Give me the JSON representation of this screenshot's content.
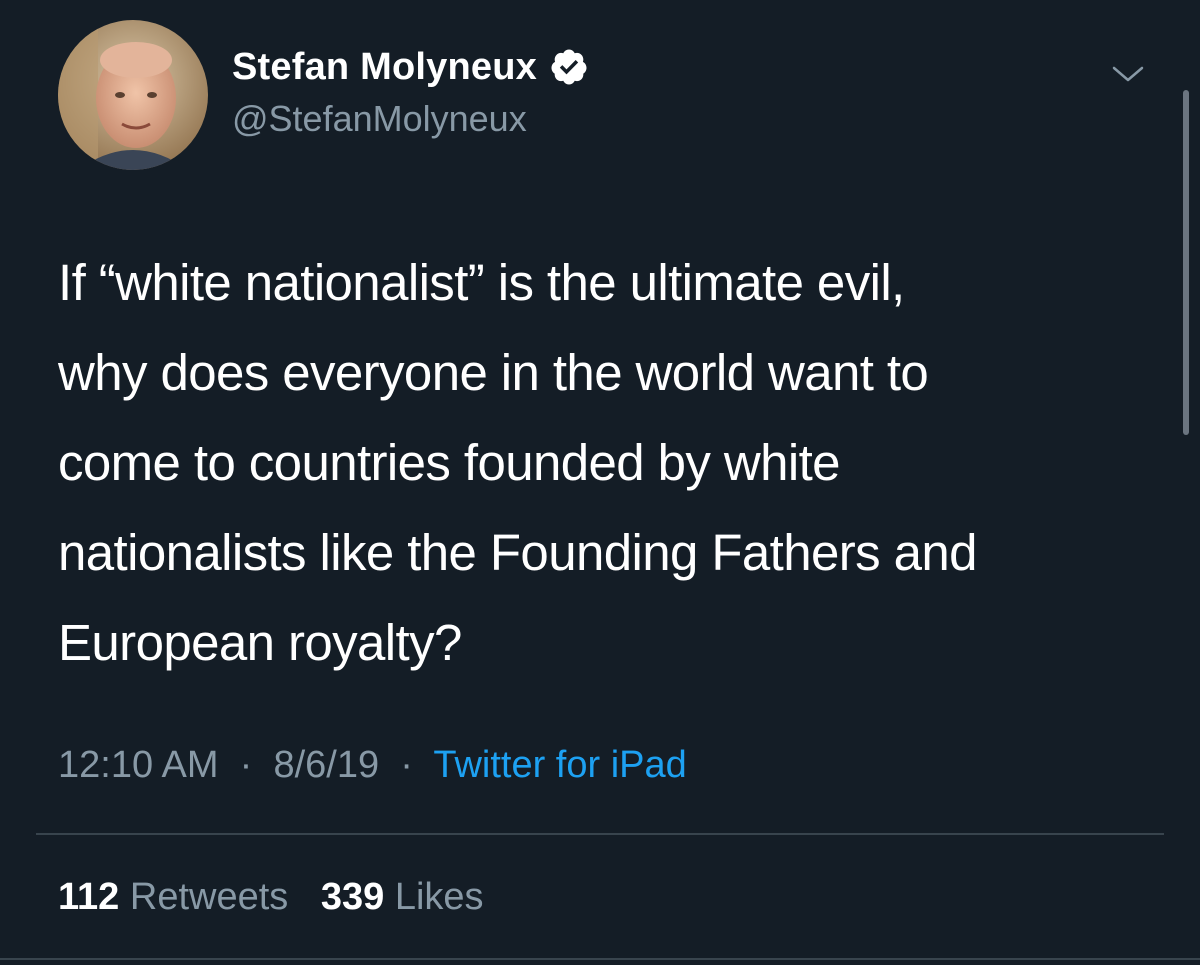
{
  "author": {
    "display_name": "Stefan Molyneux",
    "handle": "@StefanMolyneux",
    "verified": true
  },
  "tweet": {
    "text": "If “white nationalist” is the ultimate evil,\nwhy does everyone in the world want to\ncome to countries founded by white\nnationalists like the Founding Fathers and\nEuropean royalty?",
    "time": "12:10 AM",
    "date": "8/6/19",
    "separator": "·",
    "source": "Twitter for iPad"
  },
  "stats": {
    "retweets_count": "112",
    "retweets_label": "Retweets",
    "likes_count": "339",
    "likes_label": "Likes"
  },
  "icons": {
    "verified": "verified-badge-icon",
    "menu": "chevron-down-icon"
  },
  "colors": {
    "background": "#141d26",
    "secondary_text": "#8899a6",
    "link": "#1da1f2",
    "divider": "#38444d"
  }
}
